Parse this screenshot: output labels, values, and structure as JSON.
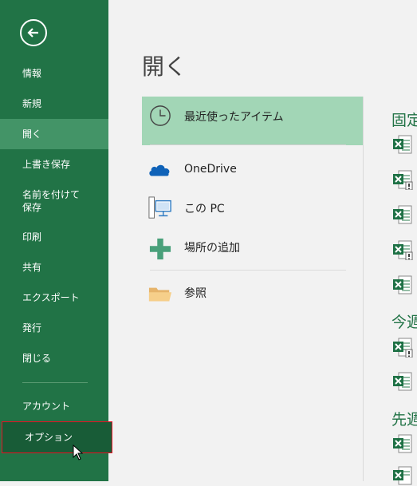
{
  "sidebar": {
    "items": [
      {
        "label": "情報"
      },
      {
        "label": "新規"
      },
      {
        "label": "開く"
      },
      {
        "label": "上書き保存"
      },
      {
        "label": "名前を付けて"
      },
      {
        "label": "印刷"
      },
      {
        "label": "共有"
      },
      {
        "label": "エクスポート"
      },
      {
        "label": "発行"
      },
      {
        "label": "閉じる"
      },
      {
        "label": "アカウント"
      },
      {
        "label": "オプション"
      }
    ],
    "save_as_line2": "保存"
  },
  "main": {
    "title": "開く",
    "locations": [
      {
        "label": "最近使ったアイテム",
        "icon": "clock-icon"
      },
      {
        "label": "OneDrive",
        "icon": "onedrive-icon"
      },
      {
        "label": "この PC",
        "icon": "this-pc-icon"
      },
      {
        "label": "場所の追加",
        "icon": "plus-icon"
      },
      {
        "label": "参照",
        "icon": "folder-icon"
      }
    ]
  },
  "recent_panel": {
    "sections": [
      "固定",
      "今週",
      "先週"
    ]
  },
  "colors": {
    "sidebar": "#217346",
    "active": "#439467",
    "selected_location": "#a2d6b6",
    "highlight_border": "#e81123"
  }
}
